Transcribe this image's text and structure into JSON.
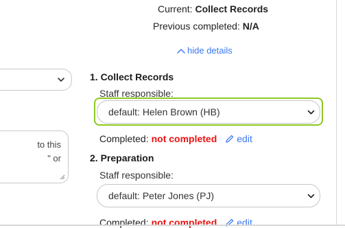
{
  "summary": {
    "current_label": "Current:",
    "current_value": "Collect Records",
    "previous_label": "Previous completed:",
    "previous_value": "N/A",
    "hide_details": "hide details"
  },
  "left_panel": {
    "textarea_line1": "to this",
    "textarea_line2": "\" or"
  },
  "steps": [
    {
      "title": "1. Collect Records",
      "staff_label": "Staff responsible:",
      "staff_value": "default: Helen Brown (HB)",
      "completed_label": "Completed:",
      "completed_status": "not completed",
      "edit_label": "edit"
    },
    {
      "title": "2. Preparation",
      "staff_label": "Staff responsible:",
      "staff_value": "default: Peter Jones (PJ)",
      "completed_label": "Completed:",
      "completed_status": "not completed",
      "edit_label": "edit"
    }
  ],
  "colors": {
    "link": "#3a78f2",
    "status_red": "#ee1111",
    "focus_green": "#8dc81f"
  },
  "icons": {
    "chevron": "chevron-down-icon",
    "chevron_up": "chevron-up-icon",
    "edit": "pencil-icon"
  }
}
